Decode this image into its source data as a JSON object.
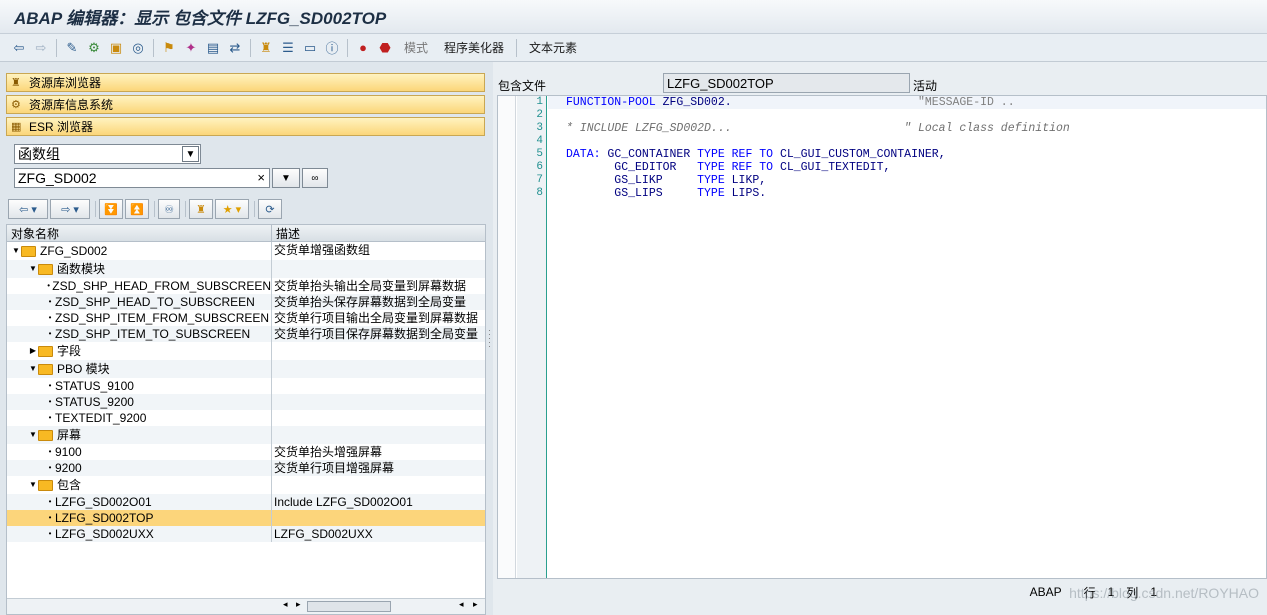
{
  "window": {
    "title": "ABAP 编辑器：显示 包含文件 LZFG_SD002TOP"
  },
  "toolbar": {
    "items": [
      "模式",
      "程序美化器",
      "文本元素"
    ]
  },
  "nav": {
    "repository_browser": "资源库浏览器",
    "repository_info_system": "资源库信息系统",
    "esr_browser": "ESR 浏览器"
  },
  "selector": {
    "type_value": "函数组",
    "object_value": "ZFG_SD002",
    "clear_glyph": "×"
  },
  "tree": {
    "col_name": "对象名称",
    "col_desc": "描述",
    "rows": [
      {
        "name": "ZFG_SD002",
        "desc": "交货单增强函数组",
        "level": 0,
        "kind": "folder"
      },
      {
        "name": "函数模块",
        "desc": "",
        "level": 1,
        "kind": "folder"
      },
      {
        "name": "ZSD_SHP_HEAD_FROM_SUBSCREEN",
        "desc": "交货单抬头输出全局变量到屏幕数据",
        "level": 2,
        "kind": "leaf"
      },
      {
        "name": "ZSD_SHP_HEAD_TO_SUBSCREEN",
        "desc": "交货单抬头保存屏幕数据到全局变量",
        "level": 2,
        "kind": "leaf"
      },
      {
        "name": "ZSD_SHP_ITEM_FROM_SUBSCREEN",
        "desc": "交货单行项目输出全局变量到屏幕数据",
        "level": 2,
        "kind": "leaf"
      },
      {
        "name": "ZSD_SHP_ITEM_TO_SUBSCREEN",
        "desc": "交货单行项目保存屏幕数据到全局变量",
        "level": 2,
        "kind": "leaf"
      },
      {
        "name": "字段",
        "desc": "",
        "level": 1,
        "kind": "folder-collapsed"
      },
      {
        "name": "PBO 模块",
        "desc": "",
        "level": 1,
        "kind": "folder"
      },
      {
        "name": "STATUS_9100",
        "desc": "",
        "level": 2,
        "kind": "leaf"
      },
      {
        "name": "STATUS_9200",
        "desc": "",
        "level": 2,
        "kind": "leaf"
      },
      {
        "name": "TEXTEDIT_9200",
        "desc": "",
        "level": 2,
        "kind": "leaf"
      },
      {
        "name": "屏幕",
        "desc": "",
        "level": 1,
        "kind": "folder"
      },
      {
        "name": "9100",
        "desc": "交货单抬头增强屏幕",
        "level": 2,
        "kind": "leaf"
      },
      {
        "name": "9200",
        "desc": "交货单行项目增强屏幕",
        "level": 2,
        "kind": "leaf"
      },
      {
        "name": "包含",
        "desc": "",
        "level": 1,
        "kind": "folder"
      },
      {
        "name": "LZFG_SD002O01",
        "desc": "Include LZFG_SD002O01",
        "level": 2,
        "kind": "leaf"
      },
      {
        "name": "LZFG_SD002TOP",
        "desc": "",
        "level": 2,
        "kind": "leaf",
        "selected": true
      },
      {
        "name": "LZFG_SD002UXX",
        "desc": "LZFG_SD002UXX",
        "level": 2,
        "kind": "leaf"
      }
    ]
  },
  "editor": {
    "include_label": "包含文件",
    "include_name": "LZFG_SD002TOP",
    "status": "活动",
    "line_numbers": [
      "1",
      "2",
      "3",
      "4",
      "5",
      "6",
      "7",
      "8"
    ],
    "lines": [
      [
        "kw",
        "FUNCTION-POOL"
      ],
      [],
      [],
      [],
      [
        "kw",
        "DATA:"
      ],
      [],
      [],
      []
    ],
    "code": {
      "l1_kw": "FUNCTION-POOL",
      "l1_rest": " ZFG_SD002.",
      "l1_cm": "\"MESSAGE-ID ..",
      "l3_cm": "* INCLUDE LZFG_SD002D...",
      "l3_cm2": "\" Local class definition",
      "l5_kw": "DATA:",
      "l5_var": " GC_CONTAINER",
      "l5_type": "TYPE REF TO",
      "l5_ref": " CL_GUI_CUSTOM_CONTAINER,",
      "l6_var": "       GC_EDITOR   ",
      "l6_type": "TYPE REF TO",
      "l6_ref": " CL_GUI_TEXTEDIT,",
      "l7_var": "       GS_LIKP     ",
      "l7_type": "TYPE",
      "l7_ref": " LIKP,",
      "l8_var": "       GS_LIPS     ",
      "l8_type": "TYPE",
      "l8_ref": " LIPS."
    }
  },
  "status": {
    "lang": "ABAP",
    "row_label": "行",
    "row_value": "1",
    "col_label": "列",
    "col_value": "1"
  },
  "watermark": "https://blog.csdn.net/ROYHAO"
}
